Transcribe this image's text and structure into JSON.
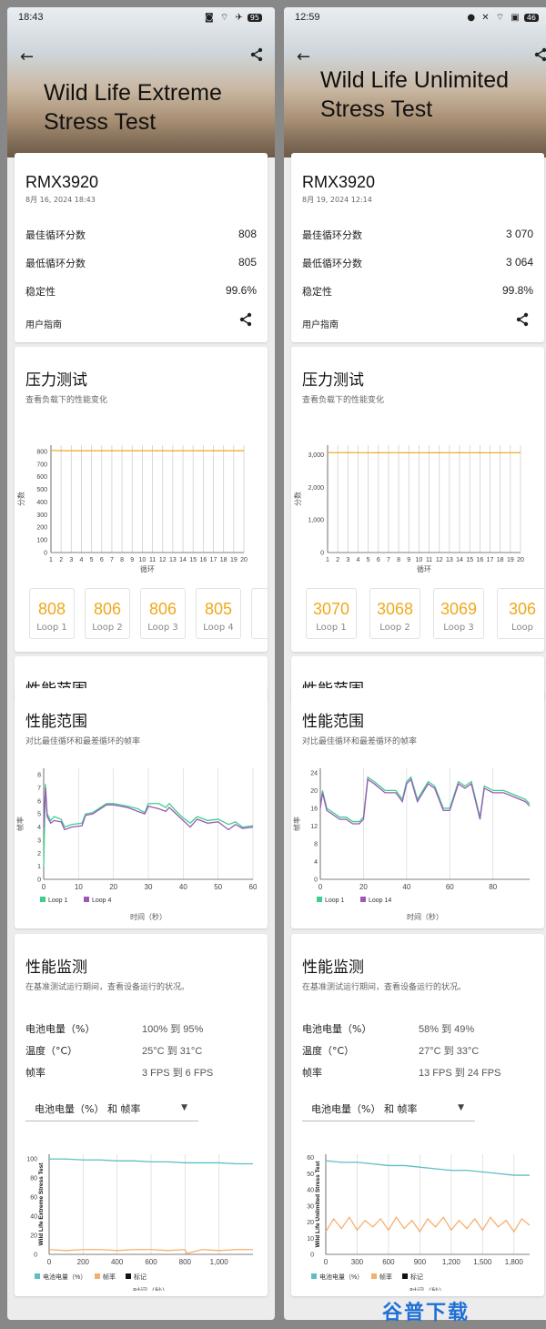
{
  "phones": [
    {
      "status": {
        "time": "18:43",
        "icons": "◙ ⌔ ✈",
        "battery": "95"
      },
      "hero_title": "Wild Life Extreme Stress Test",
      "summary": {
        "device": "RMX3920",
        "date": "8月 16, 2024 18:43",
        "best_label": "最佳循环分数",
        "best_value": "808",
        "worst_label": "最低循环分数",
        "worst_value": "805",
        "stability_label": "稳定性",
        "stability_value": "99.6%",
        "guide": "用户指南"
      },
      "stress": {
        "title": "压力测试",
        "subtitle": "查看负载下的性能变化",
        "loops": [
          {
            "score": "808",
            "label": "Loop 1"
          },
          {
            "score": "806",
            "label": "Loop 2"
          },
          {
            "score": "806",
            "label": "Loop 3"
          },
          {
            "score": "805",
            "label": "Loop 4"
          }
        ]
      },
      "peek_title": "性能范围",
      "perf": {
        "title": "性能范围",
        "subtitle": "对比最佳循环和最差循环的帧率"
      },
      "monitor": {
        "title": "性能监测",
        "subtitle": "在基准测试运行期间，查看设备运行的状况。",
        "rows": [
          {
            "label": "电池电量（%）",
            "value": "100% 到 95%"
          },
          {
            "label": "温度（°C）",
            "value": "25°C 到 31°C"
          },
          {
            "label": "帧率",
            "value": "3 FPS 到 6 FPS"
          }
        ],
        "dropdown": "电池电量（%） 和 帧率"
      }
    },
    {
      "status": {
        "time": "12:59",
        "icons": "● ✕ ⌔ ▣",
        "battery": "46"
      },
      "hero_title": "Wild Life Unlimited Stress Test",
      "summary": {
        "device": "RMX3920",
        "date": "8月 19, 2024 12:14",
        "best_label": "最佳循环分数",
        "best_value": "3 070",
        "worst_label": "最低循环分数",
        "worst_value": "3 064",
        "stability_label": "稳定性",
        "stability_value": "99.8%",
        "guide": "用户指南"
      },
      "stress": {
        "title": "压力测试",
        "subtitle": "查看负载下的性能变化",
        "loops": [
          {
            "score": "3070",
            "label": "Loop 1"
          },
          {
            "score": "3068",
            "label": "Loop 2"
          },
          {
            "score": "3069",
            "label": "Loop 3"
          },
          {
            "score": "306",
            "label": "Loop"
          }
        ]
      },
      "peek_title": "性能范围",
      "perf": {
        "title": "性能范围",
        "subtitle": "对比最佳循环和最差循环的帧率"
      },
      "monitor": {
        "title": "性能监测",
        "subtitle": "在基准测试运行期间，查看设备运行的状况。",
        "rows": [
          {
            "label": "电池电量（%）",
            "value": "58% 到 49%"
          },
          {
            "label": "温度（°C）",
            "value": "27°C 到 33°C"
          },
          {
            "label": "帧率",
            "value": "13 FPS 到 24 FPS"
          }
        ],
        "dropdown": "电池电量（%） 和 帧率"
      }
    }
  ],
  "colors": {
    "accent_orange": "#f0a81c",
    "loop_best": "#3ecf8e",
    "loop_worst": "#9b59b6",
    "battery": "#5bbfc4",
    "fps": "#f5b070",
    "marker": "#111111"
  },
  "chart_data": [
    {
      "type": "line",
      "id": "left-stress",
      "ylabel": "分数",
      "xlabel": "循环",
      "x": [
        1,
        2,
        3,
        4,
        5,
        6,
        7,
        8,
        9,
        10,
        11,
        12,
        13,
        14,
        15,
        16,
        17,
        18,
        19,
        20
      ],
      "yticks": [
        0,
        100,
        200,
        300,
        400,
        500,
        600,
        700,
        800
      ],
      "ylim": [
        0,
        850
      ],
      "series": [
        {
          "values": [
            808,
            806,
            806,
            805,
            806,
            806,
            806,
            806,
            806,
            806,
            806,
            806,
            805,
            806,
            806,
            806,
            806,
            806,
            806,
            806
          ]
        }
      ]
    },
    {
      "type": "line",
      "id": "right-stress",
      "ylabel": "分数",
      "xlabel": "循环",
      "x": [
        1,
        2,
        3,
        4,
        5,
        6,
        7,
        8,
        9,
        10,
        11,
        12,
        13,
        14,
        15,
        16,
        17,
        18,
        19,
        20
      ],
      "yticks": [
        0,
        1000,
        2000,
        3000
      ],
      "ytick_labels": [
        "0",
        "1,000",
        "2,000",
        "3,000"
      ],
      "ylim": [
        0,
        3300
      ],
      "series": [
        {
          "values": [
            3070,
            3068,
            3069,
            3067,
            3068,
            3066,
            3067,
            3068,
            3066,
            3067,
            3065,
            3066,
            3067,
            3066,
            3068,
            3065,
            3064,
            3066,
            3067,
            3066
          ]
        }
      ]
    },
    {
      "type": "line",
      "id": "left-perf",
      "ylabel": "帧率",
      "xlabel": "时间（秒）",
      "xticks": [
        0,
        10,
        20,
        30,
        40,
        50,
        60
      ],
      "yticks": [
        0,
        1,
        2,
        3,
        4,
        5,
        6,
        7,
        8
      ],
      "xlim": [
        0,
        60
      ],
      "ylim": [
        0,
        8.5
      ],
      "series": [
        {
          "name": "Loop 1",
          "x": [
            0,
            0.5,
            1,
            2,
            3,
            5,
            6,
            8,
            11,
            12,
            14,
            18,
            20,
            24,
            27,
            29,
            30,
            33,
            35,
            36,
            38,
            40,
            42,
            44,
            47,
            50,
            53,
            55,
            57,
            60
          ],
          "values": [
            1,
            7.3,
            5,
            4.5,
            4.8,
            4.6,
            4,
            4.2,
            4.3,
            5,
            5.1,
            5.8,
            5.8,
            5.6,
            5.4,
            5.1,
            5.8,
            5.8,
            5.5,
            5.8,
            5.2,
            4.7,
            4.3,
            4.8,
            4.5,
            4.6,
            4.2,
            4.4,
            4.0,
            4.1
          ]
        },
        {
          "name": "Loop 4",
          "x": [
            0,
            0.5,
            1,
            2,
            3,
            5,
            6,
            8,
            11,
            12,
            14,
            18,
            20,
            24,
            27,
            29,
            30,
            33,
            35,
            36,
            38,
            40,
            42,
            44,
            47,
            50,
            53,
            55,
            57,
            60
          ],
          "values": [
            4,
            7.0,
            4.8,
            4.3,
            4.5,
            4.4,
            3.8,
            4.0,
            4.1,
            4.9,
            5.0,
            5.7,
            5.7,
            5.5,
            5.2,
            5.0,
            5.6,
            5.4,
            5.2,
            5.5,
            5.0,
            4.5,
            4.0,
            4.6,
            4.3,
            4.4,
            3.8,
            4.2,
            3.9,
            4.0
          ]
        }
      ]
    },
    {
      "type": "line",
      "id": "right-perf",
      "ylabel": "帧率",
      "xlabel": "时间（秒）",
      "xticks": [
        0,
        20,
        40,
        60,
        80
      ],
      "yticks": [
        0,
        4,
        8,
        12,
        16,
        20,
        24
      ],
      "xlim": [
        0,
        97
      ],
      "ylim": [
        0,
        25
      ],
      "series": [
        {
          "name": "Loop 1",
          "x": [
            0,
            1,
            3,
            6,
            9,
            12,
            15,
            18,
            20,
            22,
            25,
            30,
            35,
            38,
            40,
            42,
            45,
            50,
            53,
            57,
            60,
            64,
            67,
            70,
            74,
            76,
            80,
            85,
            90,
            95,
            97
          ],
          "values": [
            16,
            20,
            16,
            15,
            14,
            14,
            13,
            13,
            14,
            23,
            22,
            20,
            20,
            18,
            22,
            23,
            18,
            22,
            21,
            16,
            16,
            22,
            21,
            22,
            14,
            21,
            20,
            20,
            19,
            18,
            17
          ]
        },
        {
          "name": "Loop 14",
          "x": [
            0,
            1,
            3,
            6,
            9,
            12,
            15,
            18,
            20,
            22,
            25,
            30,
            35,
            38,
            40,
            42,
            45,
            50,
            53,
            57,
            60,
            64,
            67,
            70,
            74,
            76,
            80,
            85,
            90,
            95,
            97
          ],
          "values": [
            16,
            19.5,
            15.5,
            14.5,
            13.5,
            13.5,
            12.5,
            12.5,
            13.5,
            22.5,
            21.5,
            19.5,
            19.5,
            17.5,
            21.5,
            22.5,
            17.5,
            21.5,
            20.5,
            15.5,
            15.5,
            21.5,
            20.5,
            21.5,
            13.5,
            20.5,
            19.5,
            19.5,
            18.5,
            17.5,
            16.5
          ]
        }
      ]
    },
    {
      "type": "line",
      "id": "left-monitor",
      "xlabel": "时间（秒）",
      "rotated_label": "Wild Life Extreme Stress Test",
      "xticks": [
        0,
        200,
        400,
        600,
        800,
        1000
      ],
      "xtick_labels": [
        "0",
        "200",
        "400",
        "600",
        "800",
        "1,000"
      ],
      "yticks": [
        0,
        20,
        40,
        60,
        80,
        100
      ],
      "xlim": [
        0,
        1200
      ],
      "ylim": [
        0,
        105
      ],
      "series": [
        {
          "name": "电池电量（%）",
          "x": [
            0,
            100,
            200,
            300,
            400,
            500,
            600,
            700,
            800,
            900,
            1000,
            1100,
            1200
          ],
          "values": [
            100,
            100,
            99,
            99,
            98,
            98,
            97,
            97,
            96,
            96,
            96,
            95,
            95
          ]
        },
        {
          "name": "帧率",
          "x": [
            0,
            100,
            200,
            300,
            400,
            500,
            600,
            700,
            800,
            810,
            900,
            1000,
            1100,
            1200
          ],
          "values": [
            5,
            4,
            5,
            5,
            4,
            5,
            5,
            4,
            5,
            1,
            5,
            4,
            5,
            5
          ]
        }
      ],
      "legend": [
        "电池电量（%）",
        "帧率",
        "标记"
      ]
    },
    {
      "type": "line",
      "id": "right-monitor",
      "xlabel": "时间（秒）",
      "rotated_label": "Wild Life Unlimited Stress Test",
      "xticks": [
        0,
        300,
        600,
        900,
        1200,
        1500,
        1800
      ],
      "xtick_labels": [
        "0",
        "300",
        "600",
        "900",
        "1,200",
        "1,500",
        "1,800"
      ],
      "yticks": [
        0,
        10,
        20,
        30,
        40,
        50,
        60
      ],
      "xlim": [
        0,
        1950
      ],
      "ylim": [
        0,
        62
      ],
      "series": [
        {
          "name": "电池电量（%）",
          "x": [
            0,
            150,
            300,
            450,
            600,
            750,
            900,
            1050,
            1200,
            1350,
            1500,
            1650,
            1800,
            1950
          ],
          "values": [
            58,
            57,
            57,
            56,
            55,
            55,
            54,
            53,
            52,
            52,
            51,
            50,
            49,
            49
          ]
        },
        {
          "name": "帧率",
          "x": [
            0,
            75,
            150,
            225,
            300,
            375,
            450,
            525,
            600,
            675,
            750,
            825,
            900,
            975,
            1050,
            1125,
            1200,
            1275,
            1350,
            1425,
            1500,
            1575,
            1650,
            1725,
            1800,
            1875,
            1950
          ],
          "values": [
            14,
            22,
            16,
            23,
            15,
            21,
            17,
            22,
            15,
            23,
            16,
            21,
            14,
            22,
            17,
            23,
            15,
            21,
            16,
            22,
            15,
            23,
            17,
            21,
            14,
            22,
            18
          ]
        }
      ],
      "legend": [
        "电池电量（%）",
        "帧率",
        "标记"
      ]
    }
  ]
}
